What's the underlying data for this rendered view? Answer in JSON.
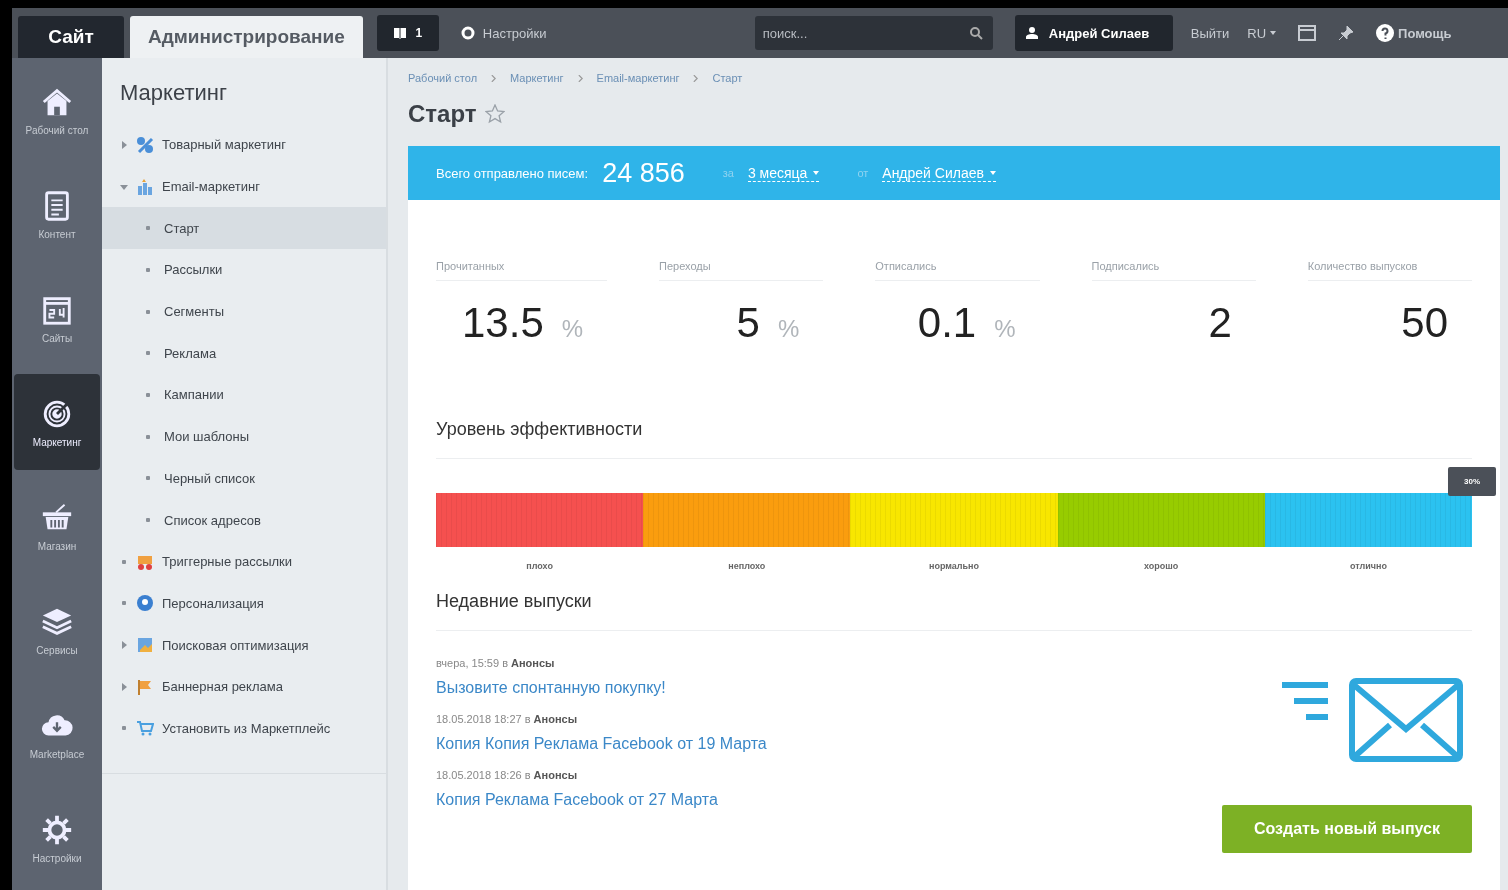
{
  "topbar": {
    "tabs": [
      {
        "label": "Сайт",
        "selected": false
      },
      {
        "label": "Администрирование",
        "selected": true
      }
    ],
    "notifications": "1",
    "settings": "Настройки",
    "search": {
      "placeholder": "поиск..."
    },
    "user": "Андрей Силаев",
    "logout": "Выйти",
    "language": "RU",
    "help": "Помощь"
  },
  "rail": [
    {
      "label": "Рабочий стол",
      "selected": false
    },
    {
      "label": "Контент",
      "selected": false
    },
    {
      "label": "Сайты",
      "selected": false
    },
    {
      "label": "Маркетинг",
      "selected": true
    },
    {
      "label": "Магазин",
      "selected": false
    },
    {
      "label": "Сервисы",
      "selected": false
    },
    {
      "label": "Marketplace",
      "selected": false
    },
    {
      "label": "Настройки",
      "selected": false
    }
  ],
  "menu": {
    "title": "Маркетинг",
    "items": [
      {
        "label": "Товарный маркетинг",
        "kind": "folder",
        "expanded": false
      },
      {
        "label": "Email-маркетинг",
        "kind": "folder",
        "expanded": true,
        "children": [
          {
            "label": "Старт",
            "selected": true
          },
          {
            "label": "Рассылки",
            "selected": false
          },
          {
            "label": "Сегменты",
            "selected": false
          },
          {
            "label": "Реклама",
            "selected": false
          },
          {
            "label": "Кампании",
            "selected": false
          },
          {
            "label": "Мои шаблоны",
            "selected": false
          },
          {
            "label": "Черный список",
            "selected": false
          },
          {
            "label": "Список адресов",
            "selected": false
          }
        ]
      },
      {
        "label": "Триггерные рассылки",
        "kind": "link",
        "expanded": false
      },
      {
        "label": "Персонализация",
        "kind": "link",
        "expanded": false
      },
      {
        "label": "Поисковая оптимизация",
        "kind": "folder",
        "expanded": false
      },
      {
        "label": "Баннерная реклама",
        "kind": "folder",
        "expanded": false
      },
      {
        "label": "Установить из Маркетплейс",
        "kind": "link",
        "expanded": false
      }
    ]
  },
  "main": {
    "breadcrumbs": [
      "Рабочий стол",
      "Маркетинг",
      "Email-маркетинг",
      "Старт"
    ],
    "title": "Старт",
    "favorite": false,
    "summary": {
      "label": "Всего отправлено писем:",
      "value": "24 856",
      "period_prefix": "за",
      "period": "3 месяца",
      "author_prefix": "от",
      "author": "Андрей Силаев"
    },
    "stats": [
      {
        "label": "Прочитанных",
        "value": "13.5",
        "unit": "%"
      },
      {
        "label": "Переходы",
        "value": "5",
        "unit": "%"
      },
      {
        "label": "Отписались",
        "value": "0.1",
        "unit": "%"
      },
      {
        "label": "Подписались",
        "value": "2"
      },
      {
        "label": "Количество выпусков",
        "value": "50"
      }
    ],
    "efficiency": {
      "title": "Уровень эффективности",
      "level": 1,
      "marker": "30%",
      "scale": [
        "плохо",
        "неплохо",
        "нормально",
        "хорошо",
        "отлично"
      ]
    },
    "recent": {
      "title": "Недавние выпуски",
      "items": [
        {
          "meta": "вчера, 15:59 в **Анонсы**",
          "title": "Вызовите спонтанную покупку!"
        },
        {
          "meta": "18.05.2018 18:27 в **Анонсы**",
          "title": "Копия Копия Реклама Facebook от 19 Марта"
        },
        {
          "meta": "18.05.2018 18:26 в **Анонсы**",
          "title": "Копия Реклама Facebook от 27 Марта"
        }
      ]
    },
    "create_button": "Создать новый выпуск"
  }
}
